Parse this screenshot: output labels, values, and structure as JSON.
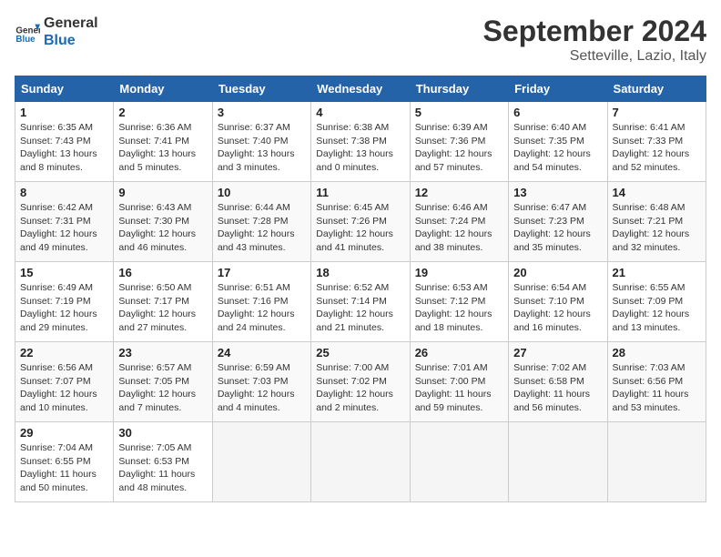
{
  "header": {
    "logo_line1": "General",
    "logo_line2": "Blue",
    "month_title": "September 2024",
    "location": "Setteville, Lazio, Italy"
  },
  "weekdays": [
    "Sunday",
    "Monday",
    "Tuesday",
    "Wednesday",
    "Thursday",
    "Friday",
    "Saturday"
  ],
  "weeks": [
    [
      {
        "day": "1",
        "sunrise": "6:35 AM",
        "sunset": "7:43 PM",
        "daylight": "13 hours and 8 minutes."
      },
      {
        "day": "2",
        "sunrise": "6:36 AM",
        "sunset": "7:41 PM",
        "daylight": "13 hours and 5 minutes."
      },
      {
        "day": "3",
        "sunrise": "6:37 AM",
        "sunset": "7:40 PM",
        "daylight": "13 hours and 3 minutes."
      },
      {
        "day": "4",
        "sunrise": "6:38 AM",
        "sunset": "7:38 PM",
        "daylight": "13 hours and 0 minutes."
      },
      {
        "day": "5",
        "sunrise": "6:39 AM",
        "sunset": "7:36 PM",
        "daylight": "12 hours and 57 minutes."
      },
      {
        "day": "6",
        "sunrise": "6:40 AM",
        "sunset": "7:35 PM",
        "daylight": "12 hours and 54 minutes."
      },
      {
        "day": "7",
        "sunrise": "6:41 AM",
        "sunset": "7:33 PM",
        "daylight": "12 hours and 52 minutes."
      }
    ],
    [
      {
        "day": "8",
        "sunrise": "6:42 AM",
        "sunset": "7:31 PM",
        "daylight": "12 hours and 49 minutes."
      },
      {
        "day": "9",
        "sunrise": "6:43 AM",
        "sunset": "7:30 PM",
        "daylight": "12 hours and 46 minutes."
      },
      {
        "day": "10",
        "sunrise": "6:44 AM",
        "sunset": "7:28 PM",
        "daylight": "12 hours and 43 minutes."
      },
      {
        "day": "11",
        "sunrise": "6:45 AM",
        "sunset": "7:26 PM",
        "daylight": "12 hours and 41 minutes."
      },
      {
        "day": "12",
        "sunrise": "6:46 AM",
        "sunset": "7:24 PM",
        "daylight": "12 hours and 38 minutes."
      },
      {
        "day": "13",
        "sunrise": "6:47 AM",
        "sunset": "7:23 PM",
        "daylight": "12 hours and 35 minutes."
      },
      {
        "day": "14",
        "sunrise": "6:48 AM",
        "sunset": "7:21 PM",
        "daylight": "12 hours and 32 minutes."
      }
    ],
    [
      {
        "day": "15",
        "sunrise": "6:49 AM",
        "sunset": "7:19 PM",
        "daylight": "12 hours and 29 minutes."
      },
      {
        "day": "16",
        "sunrise": "6:50 AM",
        "sunset": "7:17 PM",
        "daylight": "12 hours and 27 minutes."
      },
      {
        "day": "17",
        "sunrise": "6:51 AM",
        "sunset": "7:16 PM",
        "daylight": "12 hours and 24 minutes."
      },
      {
        "day": "18",
        "sunrise": "6:52 AM",
        "sunset": "7:14 PM",
        "daylight": "12 hours and 21 minutes."
      },
      {
        "day": "19",
        "sunrise": "6:53 AM",
        "sunset": "7:12 PM",
        "daylight": "12 hours and 18 minutes."
      },
      {
        "day": "20",
        "sunrise": "6:54 AM",
        "sunset": "7:10 PM",
        "daylight": "12 hours and 16 minutes."
      },
      {
        "day": "21",
        "sunrise": "6:55 AM",
        "sunset": "7:09 PM",
        "daylight": "12 hours and 13 minutes."
      }
    ],
    [
      {
        "day": "22",
        "sunrise": "6:56 AM",
        "sunset": "7:07 PM",
        "daylight": "12 hours and 10 minutes."
      },
      {
        "day": "23",
        "sunrise": "6:57 AM",
        "sunset": "7:05 PM",
        "daylight": "12 hours and 7 minutes."
      },
      {
        "day": "24",
        "sunrise": "6:59 AM",
        "sunset": "7:03 PM",
        "daylight": "12 hours and 4 minutes."
      },
      {
        "day": "25",
        "sunrise": "7:00 AM",
        "sunset": "7:02 PM",
        "daylight": "12 hours and 2 minutes."
      },
      {
        "day": "26",
        "sunrise": "7:01 AM",
        "sunset": "7:00 PM",
        "daylight": "11 hours and 59 minutes."
      },
      {
        "day": "27",
        "sunrise": "7:02 AM",
        "sunset": "6:58 PM",
        "daylight": "11 hours and 56 minutes."
      },
      {
        "day": "28",
        "sunrise": "7:03 AM",
        "sunset": "6:56 PM",
        "daylight": "11 hours and 53 minutes."
      }
    ],
    [
      {
        "day": "29",
        "sunrise": "7:04 AM",
        "sunset": "6:55 PM",
        "daylight": "11 hours and 50 minutes."
      },
      {
        "day": "30",
        "sunrise": "7:05 AM",
        "sunset": "6:53 PM",
        "daylight": "11 hours and 48 minutes."
      },
      null,
      null,
      null,
      null,
      null
    ]
  ]
}
